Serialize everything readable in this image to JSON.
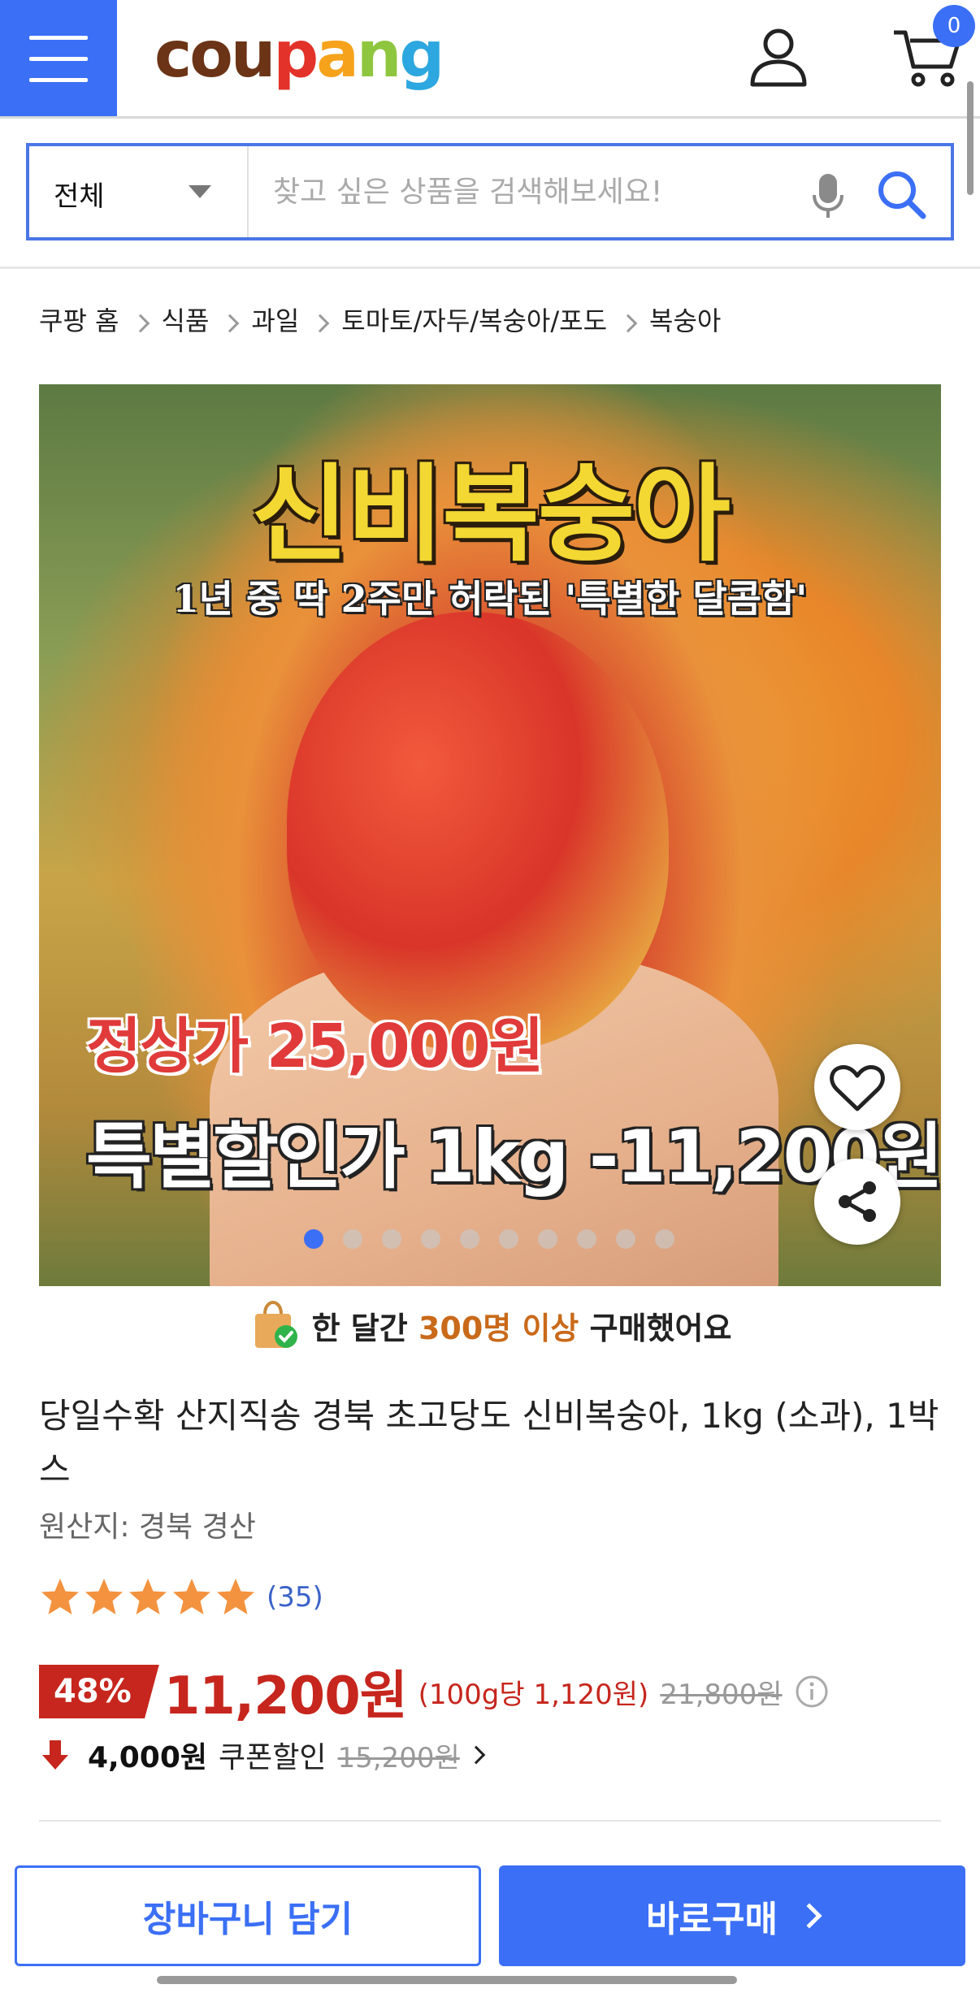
{
  "header": {
    "logo": [
      "c",
      "o",
      "u",
      "p",
      "a",
      "n",
      "g"
    ],
    "cart_count": "0"
  },
  "search": {
    "category": "전체",
    "placeholder": "찾고 싶은 상품을 검색해보세요!"
  },
  "breadcrumb": [
    "쿠팡 홈",
    "식품",
    "과일",
    "토마토/자두/복숭아/포도",
    "복숭아"
  ],
  "product_image": {
    "title": "신비복숭아",
    "subtitle": "1년 중 딱 2주만 허락된 '특별한 달콤함'",
    "normal_price": "정상가 25,000원",
    "special_price": "특별할인가 1kg -11,200원",
    "slide_count": 10,
    "active_slide": 1
  },
  "social_proof": {
    "prefix": "한 달간",
    "highlight": "300명 이상",
    "suffix": "구매했어요"
  },
  "product": {
    "title": "당일수확 산지직송 경북 초고당도 신비복숭아, 1kg (소과), 1박스",
    "origin": "원산지: 경북 경산",
    "rating": 5,
    "review_count": "(35)"
  },
  "price": {
    "discount": "48%",
    "sale_price": "11,200원",
    "unit_price": "(100g당 1,120원)",
    "original_price": "21,800원"
  },
  "coupon": {
    "amount": "4,000원",
    "label": "쿠폰할인",
    "before_price": "15,200원"
  },
  "buttons": {
    "cart": "장바구니 담기",
    "buy": "바로구매"
  },
  "colors": {
    "brand_blue": "#3b6ff5",
    "price_red": "#c6261d",
    "highlight_orange": "#c96a1a"
  }
}
